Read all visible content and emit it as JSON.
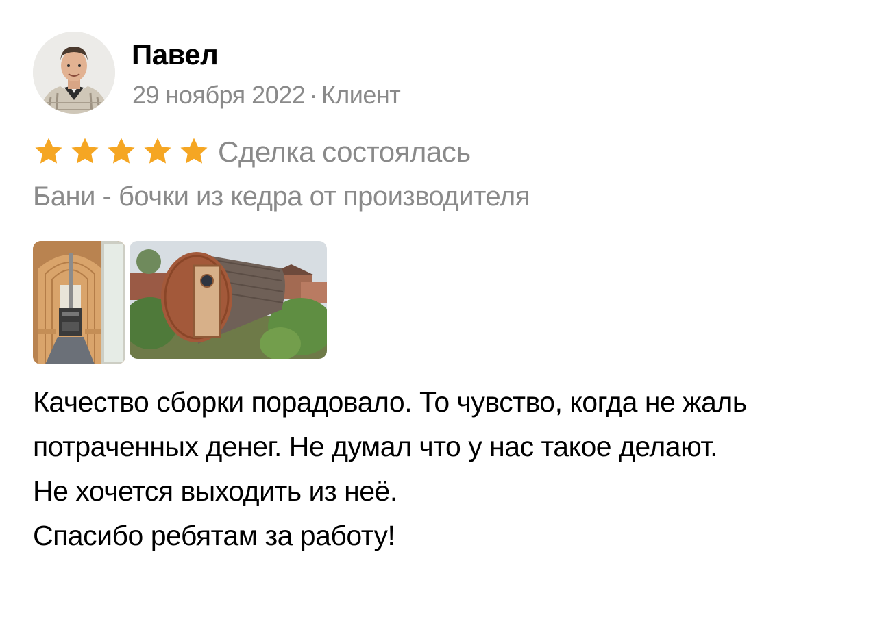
{
  "author": {
    "name": "Павел",
    "date": "29 ноября 2022",
    "separator": "·",
    "role": "Клиент"
  },
  "rating": {
    "stars": 5,
    "max": 5,
    "status": "Сделка состоялась"
  },
  "product": {
    "title": "Бани - бочки из кедра от производителя"
  },
  "photos": [
    {
      "name": "sauna-interior-photo"
    },
    {
      "name": "barrel-sauna-exterior-photo"
    }
  ],
  "review": {
    "paragraph_1": "Качество сборки порадовало. То чувство, когда не жаль потраченных денег. Не думал что у нас такое делают.",
    "paragraph_2": "Не хочется выходить из неё.",
    "paragraph_3": "Спасибо ребятам за работу!"
  },
  "colors": {
    "star": "#f5a623",
    "secondary_text": "#8a8a8a",
    "text": "#000000",
    "background": "#ffffff"
  }
}
